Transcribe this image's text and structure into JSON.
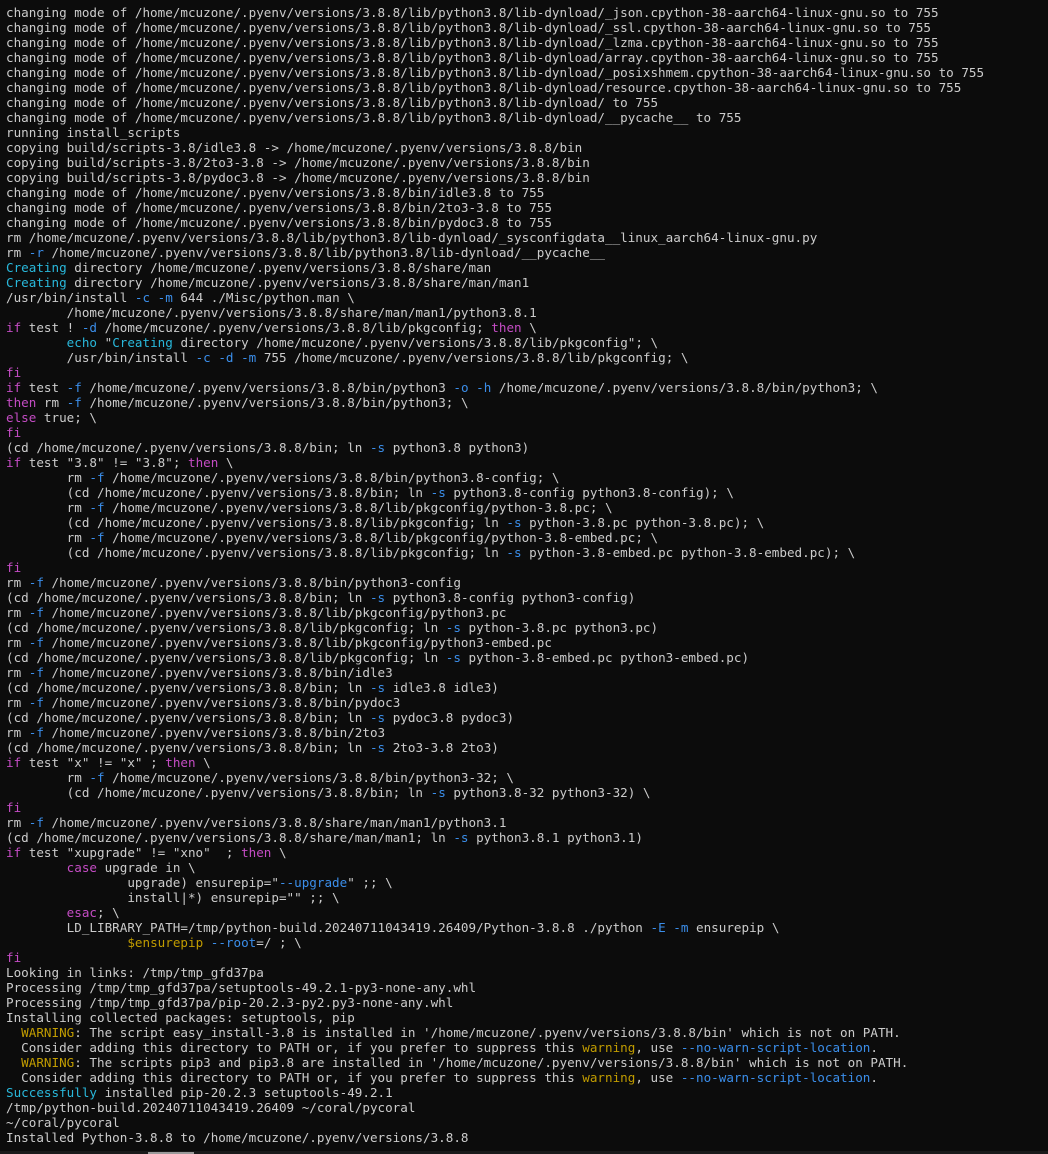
{
  "colors": {
    "background": "#0c0c0c",
    "text": "#cccccc",
    "keyword": "#c44cc4",
    "flag": "#3b8eea",
    "string": "#3b8eea",
    "variable": "#c19c00",
    "info": "#29b8db",
    "warning_label": "#c19c00",
    "warning_word": "#c19c00",
    "option": "#3b8eea",
    "success": "#29b8db"
  },
  "lines": [
    [
      {
        "t": "changing mode of /home/mcuzone/.pyenv/versions/3.8.8/lib/python3.8/lib-dynload/_json.cpython-38-aarch64-linux-gnu.so to 755",
        "c": "text"
      }
    ],
    [
      {
        "t": "changing mode of /home/mcuzone/.pyenv/versions/3.8.8/lib/python3.8/lib-dynload/_ssl.cpython-38-aarch64-linux-gnu.so to 755",
        "c": "text"
      }
    ],
    [
      {
        "t": "changing mode of /home/mcuzone/.pyenv/versions/3.8.8/lib/python3.8/lib-dynload/_lzma.cpython-38-aarch64-linux-gnu.so to 755",
        "c": "text"
      }
    ],
    [
      {
        "t": "changing mode of /home/mcuzone/.pyenv/versions/3.8.8/lib/python3.8/lib-dynload/array.cpython-38-aarch64-linux-gnu.so to 755",
        "c": "text"
      }
    ],
    [
      {
        "t": "changing mode of /home/mcuzone/.pyenv/versions/3.8.8/lib/python3.8/lib-dynload/_posixshmem.cpython-38-aarch64-linux-gnu.so to 755",
        "c": "text"
      }
    ],
    [
      {
        "t": "changing mode of /home/mcuzone/.pyenv/versions/3.8.8/lib/python3.8/lib-dynload/resource.cpython-38-aarch64-linux-gnu.so to 755",
        "c": "text"
      }
    ],
    [
      {
        "t": "changing mode of /home/mcuzone/.pyenv/versions/3.8.8/lib/python3.8/lib-dynload/ to 755",
        "c": "text"
      }
    ],
    [
      {
        "t": "changing mode of /home/mcuzone/.pyenv/versions/3.8.8/lib/python3.8/lib-dynload/__pycache__ to 755",
        "c": "text"
      }
    ],
    [
      {
        "t": "running install_scripts",
        "c": "text"
      }
    ],
    [
      {
        "t": "copying build/scripts-3.8/idle3.8 -> /home/mcuzone/.pyenv/versions/3.8.8/bin",
        "c": "text"
      }
    ],
    [
      {
        "t": "copying build/scripts-3.8/2to3-3.8 -> /home/mcuzone/.pyenv/versions/3.8.8/bin",
        "c": "text"
      }
    ],
    [
      {
        "t": "copying build/scripts-3.8/pydoc3.8 -> /home/mcuzone/.pyenv/versions/3.8.8/bin",
        "c": "text"
      }
    ],
    [
      {
        "t": "changing mode of /home/mcuzone/.pyenv/versions/3.8.8/bin/idle3.8 to 755",
        "c": "text"
      }
    ],
    [
      {
        "t": "changing mode of /home/mcuzone/.pyenv/versions/3.8.8/bin/2to3-3.8 to 755",
        "c": "text"
      }
    ],
    [
      {
        "t": "changing mode of /home/mcuzone/.pyenv/versions/3.8.8/bin/pydoc3.8 to 755",
        "c": "text"
      }
    ],
    [
      {
        "t": "rm /home/mcuzone/.pyenv/versions/3.8.8/lib/python3.8/lib-dynload/_sysconfigdata__linux_aarch64-linux-gnu.py",
        "c": "text"
      }
    ],
    [
      {
        "t": "rm ",
        "c": "text"
      },
      {
        "t": "-r",
        "c": "flag"
      },
      {
        "t": " /home/mcuzone/.pyenv/versions/3.8.8/lib/python3.8/lib-dynload/__pycache__",
        "c": "text"
      }
    ],
    [
      {
        "t": "Creating",
        "c": "info"
      },
      {
        "t": " directory /home/mcuzone/.pyenv/versions/3.8.8/share/man",
        "c": "text"
      }
    ],
    [
      {
        "t": "Creating",
        "c": "info"
      },
      {
        "t": " directory /home/mcuzone/.pyenv/versions/3.8.8/share/man/man1",
        "c": "text"
      }
    ],
    [
      {
        "t": "/usr/bin/install ",
        "c": "text"
      },
      {
        "t": "-c",
        "c": "flag"
      },
      {
        "t": " ",
        "c": "text"
      },
      {
        "t": "-m",
        "c": "flag"
      },
      {
        "t": " 644 ./Misc/python.man \\",
        "c": "text"
      }
    ],
    [
      {
        "t": "        /home/mcuzone/.pyenv/versions/3.8.8/share/man/man1/python3.8.1",
        "c": "text"
      }
    ],
    [
      {
        "t": "if",
        "c": "keyword"
      },
      {
        "t": " test ! ",
        "c": "text"
      },
      {
        "t": "-d",
        "c": "flag"
      },
      {
        "t": " /home/mcuzone/.pyenv/versions/3.8.8/lib/pkgconfig; ",
        "c": "text"
      },
      {
        "t": "then",
        "c": "keyword"
      },
      {
        "t": " \\",
        "c": "text"
      }
    ],
    [
      {
        "t": "        ",
        "c": "text"
      },
      {
        "t": "echo",
        "c": "info"
      },
      {
        "t": " \"",
        "c": "text"
      },
      {
        "t": "Creating",
        "c": "info"
      },
      {
        "t": " directory /home/mcuzone/.pyenv/versions/3.8.8/lib/pkgconfig\"; \\",
        "c": "text"
      }
    ],
    [
      {
        "t": "        /usr/bin/install ",
        "c": "text"
      },
      {
        "t": "-c",
        "c": "flag"
      },
      {
        "t": " ",
        "c": "text"
      },
      {
        "t": "-d",
        "c": "flag"
      },
      {
        "t": " ",
        "c": "text"
      },
      {
        "t": "-m",
        "c": "flag"
      },
      {
        "t": " 755 /home/mcuzone/.pyenv/versions/3.8.8/lib/pkgconfig; \\",
        "c": "text"
      }
    ],
    [
      {
        "t": "fi",
        "c": "keyword"
      }
    ],
    [
      {
        "t": "if",
        "c": "keyword"
      },
      {
        "t": " test ",
        "c": "text"
      },
      {
        "t": "-f",
        "c": "flag"
      },
      {
        "t": " /home/mcuzone/.pyenv/versions/3.8.8/bin/python3 ",
        "c": "text"
      },
      {
        "t": "-o",
        "c": "flag"
      },
      {
        "t": " ",
        "c": "text"
      },
      {
        "t": "-h",
        "c": "flag"
      },
      {
        "t": " /home/mcuzone/.pyenv/versions/3.8.8/bin/python3; \\",
        "c": "text"
      }
    ],
    [
      {
        "t": "then",
        "c": "keyword"
      },
      {
        "t": " rm ",
        "c": "text"
      },
      {
        "t": "-f",
        "c": "flag"
      },
      {
        "t": " /home/mcuzone/.pyenv/versions/3.8.8/bin/python3; \\",
        "c": "text"
      }
    ],
    [
      {
        "t": "else",
        "c": "keyword"
      },
      {
        "t": " true; \\",
        "c": "text"
      }
    ],
    [
      {
        "t": "fi",
        "c": "keyword"
      }
    ],
    [
      {
        "t": "(cd /home/mcuzone/.pyenv/versions/3.8.8/bin; ln ",
        "c": "text"
      },
      {
        "t": "-s",
        "c": "flag"
      },
      {
        "t": " python3.8 python3)",
        "c": "text"
      }
    ],
    [
      {
        "t": "if",
        "c": "keyword"
      },
      {
        "t": " test \"3.8\" != \"3.8\"; ",
        "c": "text"
      },
      {
        "t": "then",
        "c": "keyword"
      },
      {
        "t": " \\",
        "c": "text"
      }
    ],
    [
      {
        "t": "        rm ",
        "c": "text"
      },
      {
        "t": "-f",
        "c": "flag"
      },
      {
        "t": " /home/mcuzone/.pyenv/versions/3.8.8/bin/python3.8-config; \\",
        "c": "text"
      }
    ],
    [
      {
        "t": "        (cd /home/mcuzone/.pyenv/versions/3.8.8/bin; ln ",
        "c": "text"
      },
      {
        "t": "-s",
        "c": "flag"
      },
      {
        "t": " python3.8-config python3.8-config); \\",
        "c": "text"
      }
    ],
    [
      {
        "t": "        rm ",
        "c": "text"
      },
      {
        "t": "-f",
        "c": "flag"
      },
      {
        "t": " /home/mcuzone/.pyenv/versions/3.8.8/lib/pkgconfig/python-3.8.pc; \\",
        "c": "text"
      }
    ],
    [
      {
        "t": "        (cd /home/mcuzone/.pyenv/versions/3.8.8/lib/pkgconfig; ln ",
        "c": "text"
      },
      {
        "t": "-s",
        "c": "flag"
      },
      {
        "t": " python-3.8.pc python-3.8.pc); \\",
        "c": "text"
      }
    ],
    [
      {
        "t": "        rm ",
        "c": "text"
      },
      {
        "t": "-f",
        "c": "flag"
      },
      {
        "t": " /home/mcuzone/.pyenv/versions/3.8.8/lib/pkgconfig/python-3.8-embed.pc; \\",
        "c": "text"
      }
    ],
    [
      {
        "t": "        (cd /home/mcuzone/.pyenv/versions/3.8.8/lib/pkgconfig; ln ",
        "c": "text"
      },
      {
        "t": "-s",
        "c": "flag"
      },
      {
        "t": " python-3.8-embed.pc python-3.8-embed.pc); \\",
        "c": "text"
      }
    ],
    [
      {
        "t": "fi",
        "c": "keyword"
      }
    ],
    [
      {
        "t": "rm ",
        "c": "text"
      },
      {
        "t": "-f",
        "c": "flag"
      },
      {
        "t": " /home/mcuzone/.pyenv/versions/3.8.8/bin/python3-config",
        "c": "text"
      }
    ],
    [
      {
        "t": "(cd /home/mcuzone/.pyenv/versions/3.8.8/bin; ln ",
        "c": "text"
      },
      {
        "t": "-s",
        "c": "flag"
      },
      {
        "t": " python3.8-config python3-config)",
        "c": "text"
      }
    ],
    [
      {
        "t": "rm ",
        "c": "text"
      },
      {
        "t": "-f",
        "c": "flag"
      },
      {
        "t": " /home/mcuzone/.pyenv/versions/3.8.8/lib/pkgconfig/python3.pc",
        "c": "text"
      }
    ],
    [
      {
        "t": "(cd /home/mcuzone/.pyenv/versions/3.8.8/lib/pkgconfig; ln ",
        "c": "text"
      },
      {
        "t": "-s",
        "c": "flag"
      },
      {
        "t": " python-3.8.pc python3.pc)",
        "c": "text"
      }
    ],
    [
      {
        "t": "rm ",
        "c": "text"
      },
      {
        "t": "-f",
        "c": "flag"
      },
      {
        "t": " /home/mcuzone/.pyenv/versions/3.8.8/lib/pkgconfig/python3-embed.pc",
        "c": "text"
      }
    ],
    [
      {
        "t": "(cd /home/mcuzone/.pyenv/versions/3.8.8/lib/pkgconfig; ln ",
        "c": "text"
      },
      {
        "t": "-s",
        "c": "flag"
      },
      {
        "t": " python-3.8-embed.pc python3-embed.pc)",
        "c": "text"
      }
    ],
    [
      {
        "t": "rm ",
        "c": "text"
      },
      {
        "t": "-f",
        "c": "flag"
      },
      {
        "t": " /home/mcuzone/.pyenv/versions/3.8.8/bin/idle3",
        "c": "text"
      }
    ],
    [
      {
        "t": "(cd /home/mcuzone/.pyenv/versions/3.8.8/bin; ln ",
        "c": "text"
      },
      {
        "t": "-s",
        "c": "flag"
      },
      {
        "t": " idle3.8 idle3)",
        "c": "text"
      }
    ],
    [
      {
        "t": "rm ",
        "c": "text"
      },
      {
        "t": "-f",
        "c": "flag"
      },
      {
        "t": " /home/mcuzone/.pyenv/versions/3.8.8/bin/pydoc3",
        "c": "text"
      }
    ],
    [
      {
        "t": "(cd /home/mcuzone/.pyenv/versions/3.8.8/bin; ln ",
        "c": "text"
      },
      {
        "t": "-s",
        "c": "flag"
      },
      {
        "t": " pydoc3.8 pydoc3)",
        "c": "text"
      }
    ],
    [
      {
        "t": "rm ",
        "c": "text"
      },
      {
        "t": "-f",
        "c": "flag"
      },
      {
        "t": " /home/mcuzone/.pyenv/versions/3.8.8/bin/2to3",
        "c": "text"
      }
    ],
    [
      {
        "t": "(cd /home/mcuzone/.pyenv/versions/3.8.8/bin; ln ",
        "c": "text"
      },
      {
        "t": "-s",
        "c": "flag"
      },
      {
        "t": " 2to3-3.8 2to3)",
        "c": "text"
      }
    ],
    [
      {
        "t": "if",
        "c": "keyword"
      },
      {
        "t": " test \"x\" != \"x\" ; ",
        "c": "text"
      },
      {
        "t": "then",
        "c": "keyword"
      },
      {
        "t": " \\",
        "c": "text"
      }
    ],
    [
      {
        "t": "        rm ",
        "c": "text"
      },
      {
        "t": "-f",
        "c": "flag"
      },
      {
        "t": " /home/mcuzone/.pyenv/versions/3.8.8/bin/python3-32; \\",
        "c": "text"
      }
    ],
    [
      {
        "t": "        (cd /home/mcuzone/.pyenv/versions/3.8.8/bin; ln ",
        "c": "text"
      },
      {
        "t": "-s",
        "c": "flag"
      },
      {
        "t": " python3.8-32 python3-32) \\",
        "c": "text"
      }
    ],
    [
      {
        "t": "fi",
        "c": "keyword"
      }
    ],
    [
      {
        "t": "rm ",
        "c": "text"
      },
      {
        "t": "-f",
        "c": "flag"
      },
      {
        "t": " /home/mcuzone/.pyenv/versions/3.8.8/share/man/man1/python3.1",
        "c": "text"
      }
    ],
    [
      {
        "t": "(cd /home/mcuzone/.pyenv/versions/3.8.8/share/man/man1; ln ",
        "c": "text"
      },
      {
        "t": "-s",
        "c": "flag"
      },
      {
        "t": " python3.8.1 python3.1)",
        "c": "text"
      }
    ],
    [
      {
        "t": "if",
        "c": "keyword"
      },
      {
        "t": " test \"xupgrade\" != \"xno\"  ; ",
        "c": "text"
      },
      {
        "t": "then",
        "c": "keyword"
      },
      {
        "t": " \\",
        "c": "text"
      }
    ],
    [
      {
        "t": "        ",
        "c": "text"
      },
      {
        "t": "case",
        "c": "keyword"
      },
      {
        "t": " upgrade in \\",
        "c": "text"
      }
    ],
    [
      {
        "t": "                upgrade) ensurepip=\"",
        "c": "text"
      },
      {
        "t": "--upgrade",
        "c": "flag"
      },
      {
        "t": "\" ;; \\",
        "c": "text"
      }
    ],
    [
      {
        "t": "                install|*) ensurepip=\"\" ;; \\",
        "c": "text"
      }
    ],
    [
      {
        "t": "        ",
        "c": "text"
      },
      {
        "t": "esac",
        "c": "keyword"
      },
      {
        "t": "; \\",
        "c": "text"
      }
    ],
    [
      {
        "t": "        LD_LIBRARY_PATH=/tmp/python-build.20240711043419.26409/Python-3.8.8 ./python ",
        "c": "text"
      },
      {
        "t": "-E",
        "c": "flag"
      },
      {
        "t": " ",
        "c": "text"
      },
      {
        "t": "-m",
        "c": "flag"
      },
      {
        "t": " ensurepip \\",
        "c": "text"
      }
    ],
    [
      {
        "t": "                ",
        "c": "text"
      },
      {
        "t": "$ensurepip",
        "c": "variable"
      },
      {
        "t": " ",
        "c": "text"
      },
      {
        "t": "--root",
        "c": "flag"
      },
      {
        "t": "=/ ; \\",
        "c": "text"
      }
    ],
    [
      {
        "t": "fi",
        "c": "keyword"
      }
    ],
    [
      {
        "t": "Looking in links: /tmp/tmp_gfd37pa",
        "c": "text"
      }
    ],
    [
      {
        "t": "Processing /tmp/tmp_gfd37pa/setuptools-49.2.1-py3-none-any.whl",
        "c": "text"
      }
    ],
    [
      {
        "t": "Processing /tmp/tmp_gfd37pa/pip-20.2.3-py2.py3-none-any.whl",
        "c": "text"
      }
    ],
    [
      {
        "t": "Installing collected packages: setuptools, pip",
        "c": "text"
      }
    ],
    [
      {
        "t": "  ",
        "c": "text"
      },
      {
        "t": "WARNING",
        "c": "warning_label"
      },
      {
        "t": ": The script easy_install-3.8 is installed in '/home/mcuzone/.pyenv/versions/3.8.8/bin' which is not on PATH.",
        "c": "text"
      }
    ],
    [
      {
        "t": "  Consider adding this directory to PATH or, if you prefer to suppress this ",
        "c": "text"
      },
      {
        "t": "warning",
        "c": "warning_word"
      },
      {
        "t": ", use ",
        "c": "text"
      },
      {
        "t": "--no-warn-script-location",
        "c": "option"
      },
      {
        "t": ".",
        "c": "text"
      }
    ],
    [
      {
        "t": "  ",
        "c": "text"
      },
      {
        "t": "WARNING",
        "c": "warning_label"
      },
      {
        "t": ": The scripts pip3 and pip3.8 are installed in '/home/mcuzone/.pyenv/versions/3.8.8/bin' which is not on PATH.",
        "c": "text"
      }
    ],
    [
      {
        "t": "  Consider adding this directory to PATH or, if you prefer to suppress this ",
        "c": "text"
      },
      {
        "t": "warning",
        "c": "warning_word"
      },
      {
        "t": ", use ",
        "c": "text"
      },
      {
        "t": "--no-warn-script-location",
        "c": "option"
      },
      {
        "t": ".",
        "c": "text"
      }
    ],
    [
      {
        "t": "Successfully",
        "c": "success"
      },
      {
        "t": " installed pip-20.2.3 setuptools-49.2.1",
        "c": "text"
      }
    ],
    [
      {
        "t": "/tmp/python-build.20240711043419.26409 ~/coral/pycoral",
        "c": "text"
      }
    ],
    [
      {
        "t": "~/coral/pycoral",
        "c": "text"
      }
    ],
    [
      {
        "t": "Installed Python-3.8.8 to /home/mcuzone/.pyenv/versions/3.8.8",
        "c": "text"
      }
    ]
  ]
}
